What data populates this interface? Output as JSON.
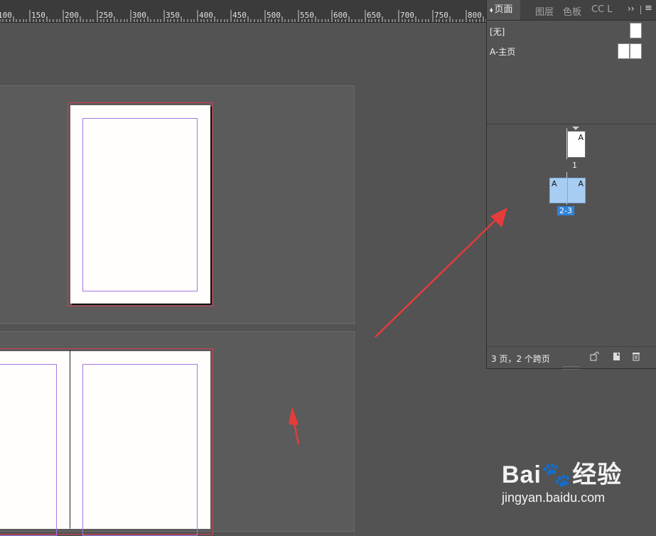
{
  "ruler": {
    "labels": [
      "100",
      "150",
      "200",
      "250",
      "300",
      "350",
      "400",
      "450",
      "500",
      "550",
      "600",
      "650",
      "700",
      "750",
      "800"
    ]
  },
  "panel": {
    "tabs": [
      {
        "label": "页面",
        "active": true
      },
      {
        "label": "图层",
        "active": false
      },
      {
        "label": "色板",
        "active": false
      },
      {
        "label": "CC L",
        "active": false
      }
    ],
    "overflow_icon": "double-chevron-right-icon",
    "menu_icon": "hamburger-menu-icon",
    "masters": [
      {
        "label": "[无]"
      },
      {
        "label": "A-主页"
      }
    ],
    "pages": [
      {
        "number": "1",
        "master": "A"
      },
      {
        "number": "2-3",
        "master_left": "A",
        "master_right": "A",
        "selected": true
      }
    ],
    "footer_text": "3 页，2 个跨页",
    "footer_icons": [
      "edit-page-size-icon",
      "new-page-icon",
      "delete-page-icon"
    ]
  },
  "watermark": {
    "logo": "Bai🐾经验",
    "url": "jingyan.baidu.com"
  },
  "colors": {
    "pasteboard": "#535353",
    "bleed": "#d43c55",
    "margin": "#a677e0",
    "selected_page": "#a8cdf2",
    "selected_label": "#2f84d8",
    "arrow": "#e63b3b"
  }
}
